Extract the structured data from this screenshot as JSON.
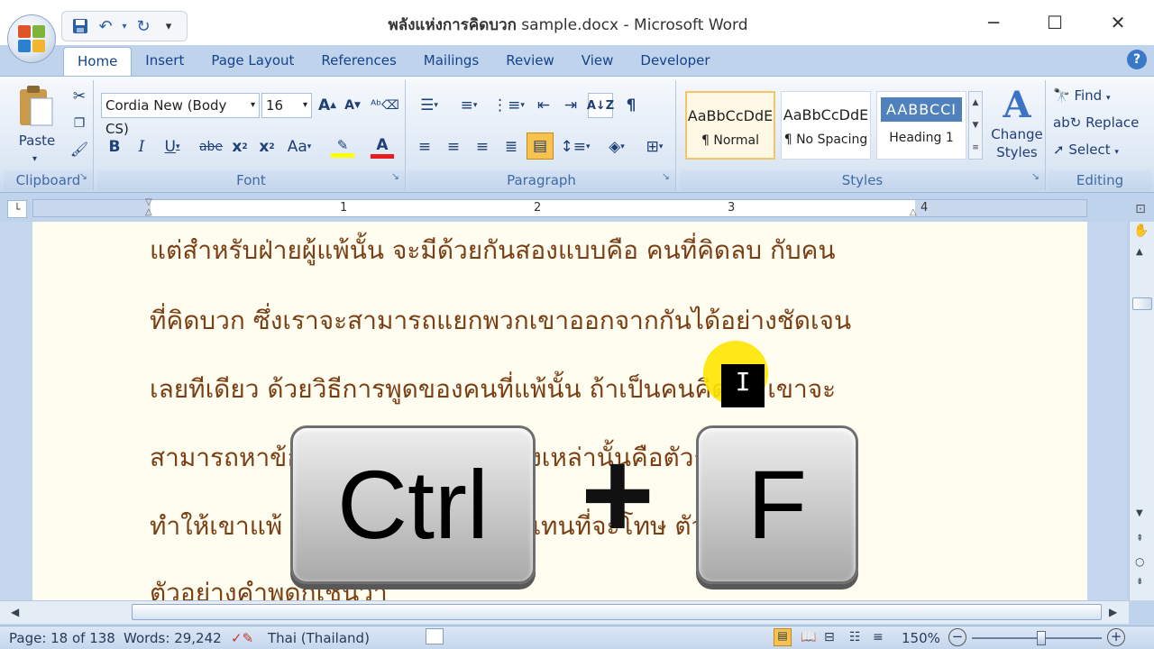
{
  "window": {
    "title_bold": "พลังแห่งการคิดบวก",
    "title_rest": " sample.docx - Microsoft Word",
    "minimize": "─",
    "maximize": "☐",
    "close": "✕"
  },
  "tabs": [
    {
      "label": "Home",
      "active": true
    },
    {
      "label": "Insert"
    },
    {
      "label": "Page Layout"
    },
    {
      "label": "References"
    },
    {
      "label": "Mailings"
    },
    {
      "label": "Review"
    },
    {
      "label": "View"
    },
    {
      "label": "Developer"
    }
  ],
  "ribbon": {
    "clipboard": {
      "label": "Clipboard",
      "paste": "Paste"
    },
    "font": {
      "label": "Font",
      "font_name": "Cordia New (Body CS)",
      "font_size": "16"
    },
    "paragraph": {
      "label": "Paragraph"
    },
    "styles": {
      "label": "Styles",
      "items": [
        {
          "sample": "AaBbCcDdE",
          "name": "¶ Normal",
          "selected": true
        },
        {
          "sample": "AaBbCcDdE",
          "name": "¶ No Spacing"
        },
        {
          "sample": "AABBCCI",
          "name": "Heading 1"
        }
      ],
      "change_styles": "Change Styles"
    },
    "editing": {
      "label": "Editing",
      "find": "Find",
      "replace": "Replace",
      "select": "Select"
    }
  },
  "ruler": {
    "marks": [
      "1",
      "2",
      "3",
      "4"
    ]
  },
  "document": {
    "lines": [
      "แต่สำหรับฝ่ายผู้แพ้นั้น จะมีด้วยกันสองแบบคือ คนที่คิดลบ กับคน",
      "ที่คิดบวก ซึ่งเราจะสามารถแยกพวกเขาออกจากกันได้อย่างชัดเจน",
      "เลยทีเดียว ด้วยวิธีการพูดของคนที่แพ้นั้น ถ้าเป็นคนคิดลบ เขาจะ",
      "สามารถหาข้ออ้างต่างๆ มาบอกว่าสิ่งเหล่านั้นคือตัวการที่แหละที่",
      "ทำให้เขาแพ้ แต่คนคิดบวก “โทษ” แทนที่จะโทษ ตัวเอง”",
      "ตัวอย่างคำพูดก็เช่นว่า"
    ]
  },
  "overlay": {
    "key1": "Ctrl",
    "plus": "+",
    "key2": "F"
  },
  "status": {
    "page": "Page: 18 of 138",
    "words": "Words: 29,242",
    "language": "Thai (Thailand)",
    "zoom": "150%"
  }
}
